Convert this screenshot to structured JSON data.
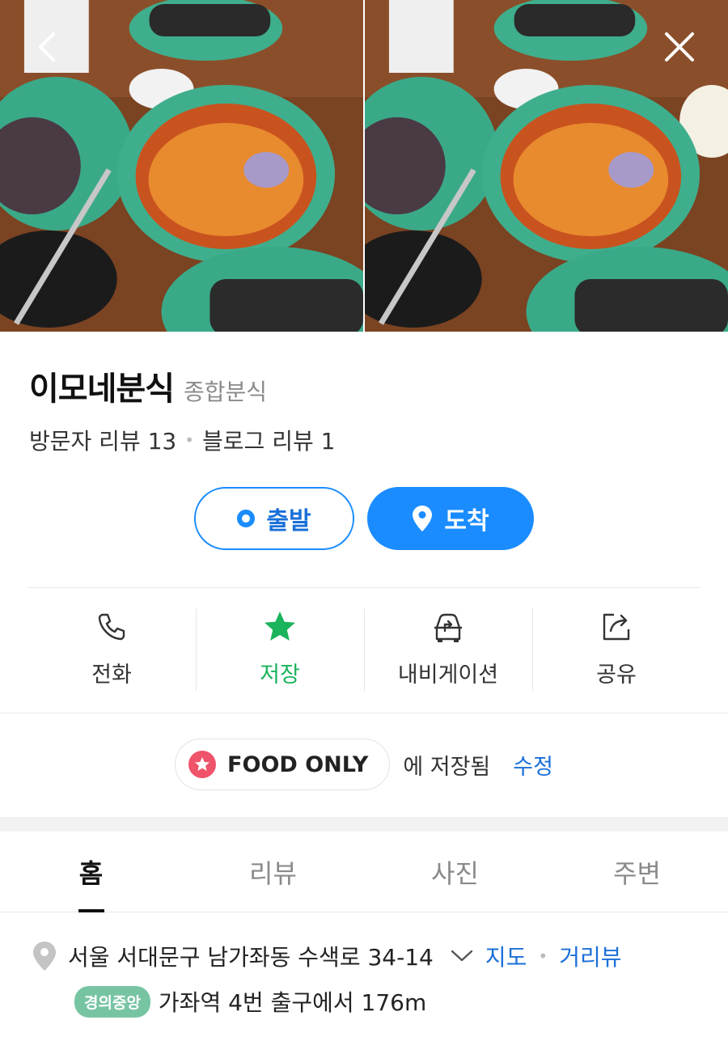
{
  "header": {
    "back_icon": "chevron-left-icon",
    "close_icon": "close-icon"
  },
  "place": {
    "name": "이모네분식",
    "category": "종합분식",
    "visitor_reviews": "방문자 리뷰 13",
    "blog_reviews": "블로그 리뷰 1"
  },
  "route": {
    "depart_label": "출발",
    "arrive_label": "도착"
  },
  "actions": [
    {
      "label": "전화",
      "icon": "phone-icon"
    },
    {
      "label": "저장",
      "icon": "star-icon",
      "active": true
    },
    {
      "label": "내비게이션",
      "icon": "car-navigation-icon"
    },
    {
      "label": "공유",
      "icon": "share-icon"
    }
  ],
  "saved": {
    "folder": "FOOD ONLY",
    "text": "에 저장됨",
    "edit": "수정"
  },
  "tabs": [
    {
      "label": "홈",
      "active": true
    },
    {
      "label": "리뷰"
    },
    {
      "label": "사진"
    },
    {
      "label": "주변"
    }
  ],
  "address": {
    "text": "서울 서대문구 남가좌동 수색로 34-14",
    "map_link": "지도",
    "street_view_link": "거리뷰"
  },
  "station": {
    "line": "경의중앙",
    "text": "가좌역 4번 출구에서 176m"
  },
  "colors": {
    "accent": "#1a8cff",
    "saved_green": "#1bb35b",
    "folder_badge": "#f0546a",
    "line_badge": "#77c4a3"
  }
}
